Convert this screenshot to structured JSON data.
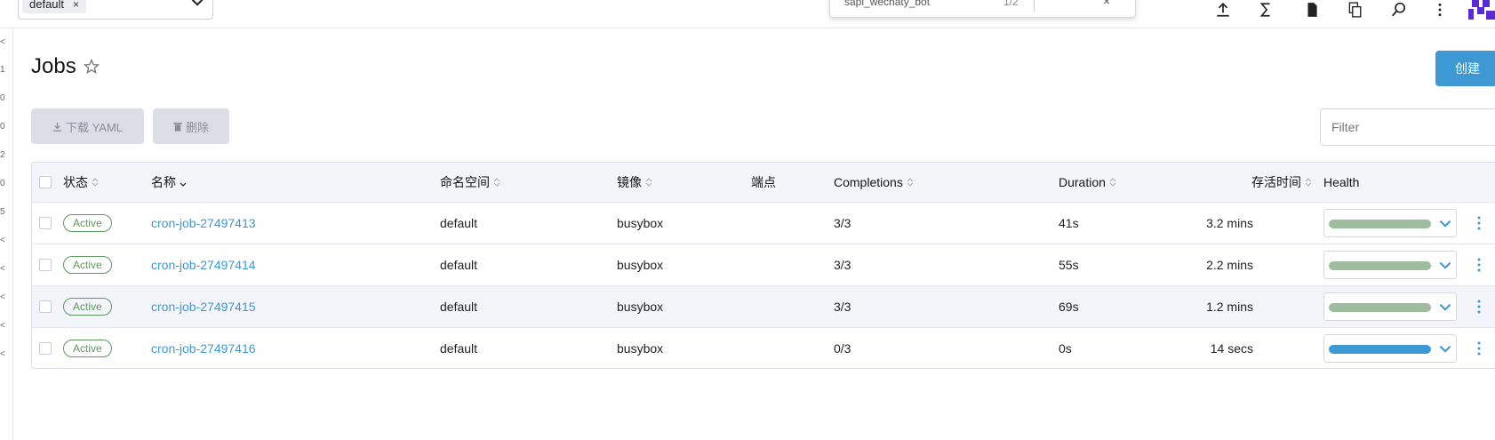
{
  "header": {
    "namespace_chip": "default",
    "namespace_chip_remove": "×",
    "search_popup": {
      "query": "sapi_wechaty_bot",
      "count": "1/2",
      "close": "×"
    },
    "icons": [
      "upload-icon",
      "sigma-icon",
      "file-icon",
      "copy-icon",
      "search-icon",
      "more-vertical-icon"
    ],
    "brand_color": "#5a2ad8"
  },
  "leftnav": {
    "marks": [
      "<",
      "1",
      "0",
      "0",
      "2",
      "0",
      "5",
      "<",
      "<",
      "<",
      "<",
      "<"
    ]
  },
  "page": {
    "title": "Jobs",
    "create_button": "创建",
    "download_yaml_button": "下载 YAML",
    "delete_button": "删除",
    "filter_placeholder": "Filter"
  },
  "table": {
    "headers": {
      "state": "状态",
      "name": "名称",
      "namespace": "命名空间",
      "image": "镜像",
      "endpoints": "端点",
      "completions": "Completions",
      "duration": "Duration",
      "age": "存活时间",
      "health": "Health"
    },
    "rows": [
      {
        "state": "Active",
        "name": "cron-job-27497413",
        "namespace": "default",
        "image": "busybox",
        "completions": "3/3",
        "duration": "41s",
        "age": "3.2 mins",
        "health_color": "#9ebc9e"
      },
      {
        "state": "Active",
        "name": "cron-job-27497414",
        "namespace": "default",
        "image": "busybox",
        "completions": "3/3",
        "duration": "55s",
        "age": "2.2 mins",
        "health_color": "#9ebc9e"
      },
      {
        "state": "Active",
        "name": "cron-job-27497415",
        "namespace": "default",
        "image": "busybox",
        "completions": "3/3",
        "duration": "69s",
        "age": "1.2 mins",
        "health_color": "#9ebc9e"
      },
      {
        "state": "Active",
        "name": "cron-job-27497416",
        "namespace": "default",
        "image": "busybox",
        "completions": "0/3",
        "duration": "0s",
        "age": "14 secs",
        "health_color": "#3d98d3"
      }
    ]
  },
  "colors": {
    "accent": "#3d98d3",
    "active_badge": "#5d995d"
  }
}
